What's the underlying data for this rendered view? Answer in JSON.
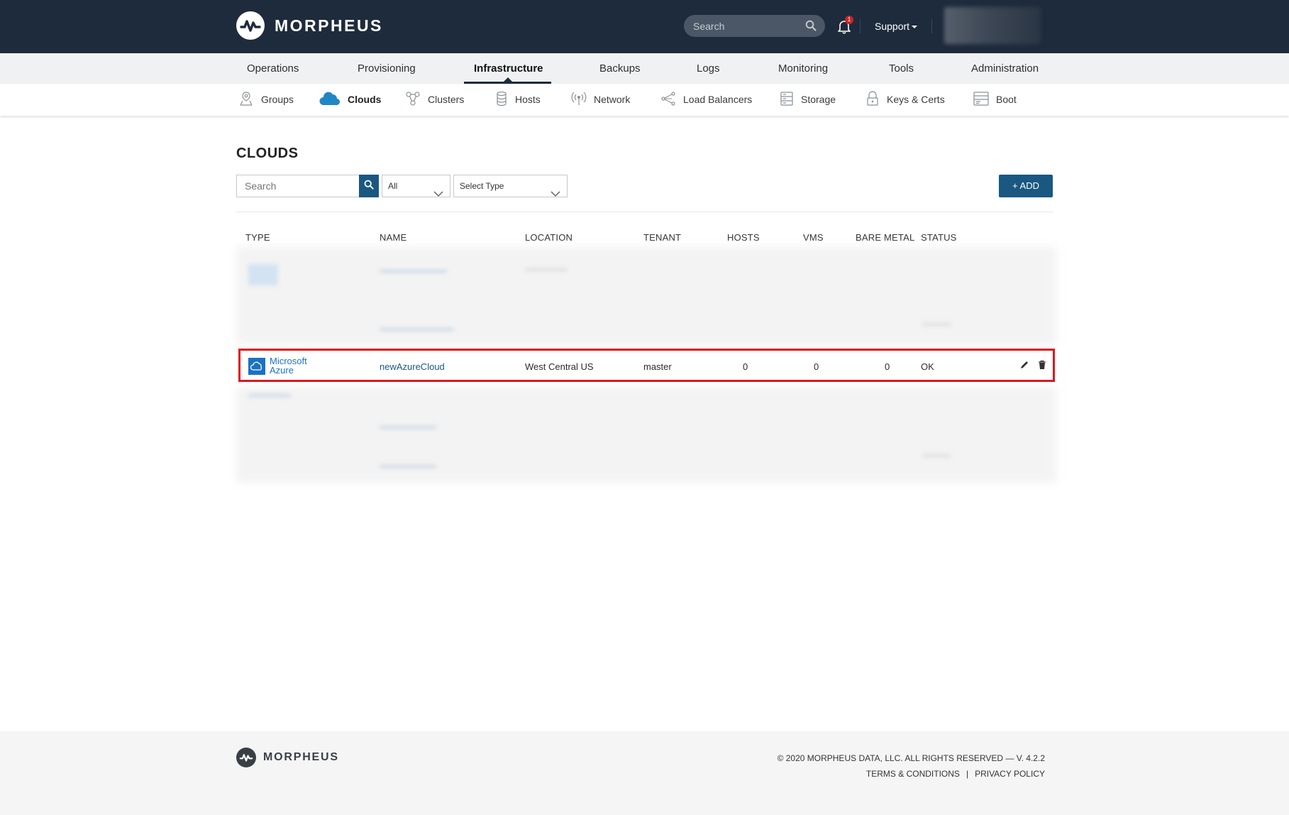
{
  "app": {
    "brand": "MORPHEUS"
  },
  "header": {
    "search_placeholder": "Search",
    "notification_count": "1",
    "support_label": "Support"
  },
  "main_nav": [
    {
      "label": "Operations"
    },
    {
      "label": "Provisioning"
    },
    {
      "label": "Infrastructure",
      "active": true
    },
    {
      "label": "Backups"
    },
    {
      "label": "Logs"
    },
    {
      "label": "Monitoring"
    },
    {
      "label": "Tools"
    },
    {
      "label": "Administration"
    }
  ],
  "sub_nav": [
    {
      "label": "Groups",
      "icon": "groups-icon"
    },
    {
      "label": "Clouds",
      "icon": "cloud-icon",
      "active": true
    },
    {
      "label": "Clusters",
      "icon": "clusters-icon"
    },
    {
      "label": "Hosts",
      "icon": "hosts-icon"
    },
    {
      "label": "Network",
      "icon": "network-icon"
    },
    {
      "label": "Load Balancers",
      "icon": "load-balancers-icon"
    },
    {
      "label": "Storage",
      "icon": "storage-icon"
    },
    {
      "label": "Keys & Certs",
      "icon": "lock-icon"
    },
    {
      "label": "Boot",
      "icon": "boot-icon"
    }
  ],
  "page": {
    "title": "CLOUDS",
    "search_placeholder": "Search",
    "filter_all": "All",
    "filter_type": "Select Type",
    "add_label": "+ ADD"
  },
  "table": {
    "headers": [
      "TYPE",
      "NAME",
      "LOCATION",
      "TENANT",
      "HOSTS",
      "VMS",
      "BARE METAL",
      "STATUS"
    ],
    "row": {
      "type_line1": "Microsoft",
      "type_line2": "Azure",
      "name": "newAzureCloud",
      "location": "West Central US",
      "tenant": "master",
      "hosts": "0",
      "vms": "0",
      "bare_metal": "0",
      "status": "OK"
    }
  },
  "footer": {
    "brand": "MORPHEUS",
    "copyright": "© 2020 MORPHEUS DATA, LLC. ALL RIGHTS RESERVED — V. 4.2.2",
    "terms": "TERMS & CONDITIONS",
    "separator": "|",
    "privacy": "PRIVACY POLICY"
  },
  "colors": {
    "header_bg": "#1e2b3c",
    "primary_button": "#1a5781",
    "highlight_border": "#e0161d",
    "azure_blue": "#1b72c1"
  }
}
